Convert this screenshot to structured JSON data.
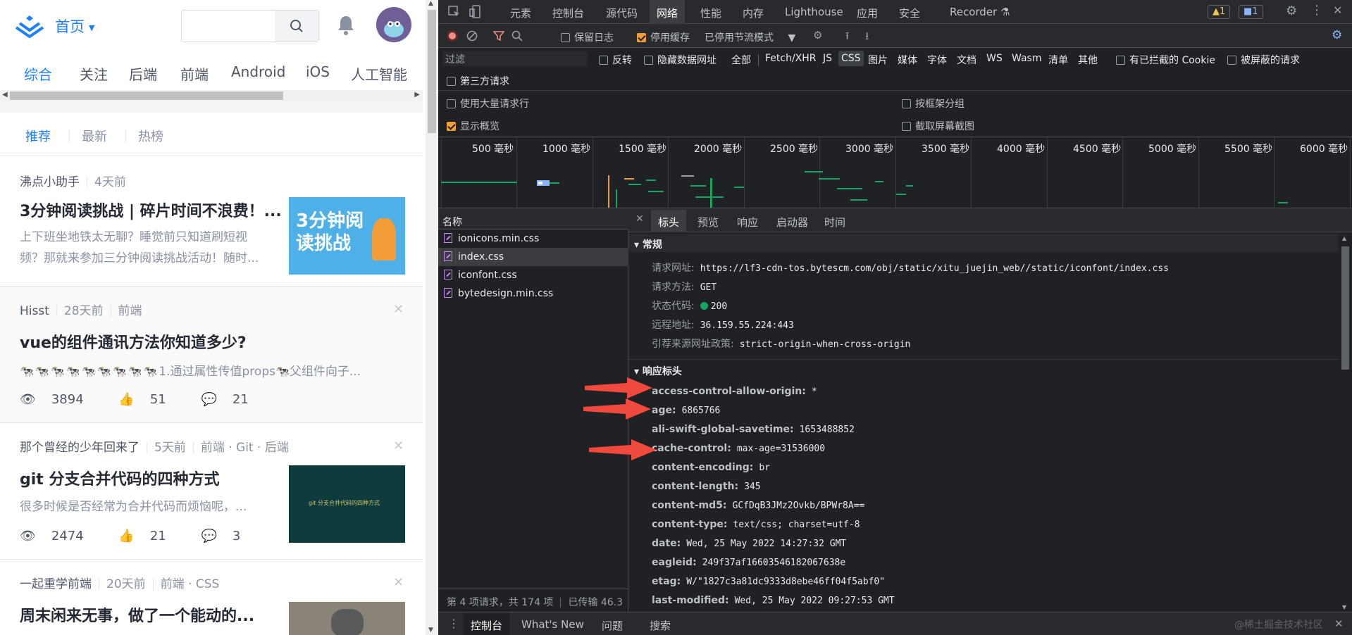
{
  "site": {
    "home_label": "首页",
    "categories": [
      "综合",
      "关注",
      "后端",
      "前端",
      "Android",
      "iOS",
      "人工智能"
    ],
    "subtabs": [
      "推荐",
      "最新",
      "热榜"
    ],
    "articles": [
      {
        "author": "沸点小助手",
        "time": "4天前",
        "tags": "",
        "title": "3分钟阅读挑战 | 碎片时间不浪费！...",
        "abstract1": "上下班坐地铁太无聊？睡觉前只知道刷短视",
        "abstract2": "频？那就来参加三分钟阅读挑战活动！随时...",
        "thumb_text": "3分钟阅读挑战"
      },
      {
        "author": "Hisst",
        "time": "28天前",
        "tags": "前端",
        "title": "vue的组件通讯方法你知道多少?",
        "abstract1": "1.通过属性传值props",
        "abstract1b": "父组件向子...",
        "views": "3894",
        "likes": "51",
        "comments": "21"
      },
      {
        "author": "那个曾经的少年回来了",
        "time": "5天前",
        "tags": "前端 · Git · 后端",
        "title": "git 分支合并代码的四种方式",
        "abstract1": "很多时候是否经常为合并代码而烦恼呢，...",
        "views": "2474",
        "likes": "21",
        "comments": "3",
        "thumb_text": "git 分支合并代码的四种方式"
      },
      {
        "author": "一起重学前端",
        "time": "20天前",
        "tags": "前端 · CSS",
        "title": "周末闲来无事，做了一个能动的..."
      }
    ]
  },
  "devtools": {
    "tabs": [
      "元素",
      "控制台",
      "源代码",
      "网络",
      "性能",
      "内存",
      "Lighthouse",
      "应用",
      "安全",
      "Recorder"
    ],
    "active_tab": "网络",
    "warn_count": "1",
    "msg_count": "1",
    "toolbar": {
      "preserve_log": "保留日志",
      "disable_cache": "停用缓存",
      "throttle": "已停用节流模式"
    },
    "filter": {
      "placeholder": "过滤",
      "invert": "反转",
      "hide_data_urls": "隐藏数据网址",
      "types": [
        "全部",
        "Fetch/XHR",
        "JS",
        "CSS",
        "图片",
        "媒体",
        "字体",
        "文档",
        "WS",
        "Wasm",
        "清单",
        "其他"
      ],
      "active_type": "CSS",
      "blocked_cookies": "有已拦截的 Cookie",
      "blocked_requests": "被屏蔽的请求",
      "third_party": "第三方请求"
    },
    "options": {
      "large_rows": "使用大量请求行",
      "group_by_frame": "按框架分组",
      "show_overview": "显示概览",
      "capture_screens": "截取屏幕截图"
    },
    "timeline_ticks": [
      "500 毫秒",
      "1000 毫秒",
      "1500 毫秒",
      "2000 毫秒",
      "2500 毫秒",
      "3000 毫秒",
      "3500 毫秒",
      "4000 毫秒",
      "4500 毫秒",
      "5000 毫秒",
      "5500 毫秒",
      "6000 毫秒"
    ],
    "name_header": "名称",
    "files": [
      "ionicons.min.css",
      "index.css",
      "iconfont.css",
      "bytedesign.min.css"
    ],
    "status_bar": "第 4 项请求，共 174 项",
    "status_bar2": "已传输 46.3",
    "detail_tabs": [
      "标头",
      "预览",
      "响应",
      "启动器",
      "时间"
    ],
    "general": {
      "title": "常规",
      "rows": [
        {
          "k": "请求网址:",
          "v": "https://lf3-cdn-tos.bytescm.com/obj/static/xitu_juejin_web//static/iconfont/index.css"
        },
        {
          "k": "请求方法:",
          "v": "GET"
        },
        {
          "k": "状态代码:",
          "v": "200"
        },
        {
          "k": "远程地址:",
          "v": "36.159.55.224:443"
        },
        {
          "k": "引荐来源网址政策:",
          "v": "strict-origin-when-cross-origin"
        }
      ]
    },
    "response_headers": {
      "title": "响应标头",
      "rows": [
        {
          "k": "access-control-allow-origin:",
          "v": "*"
        },
        {
          "k": "age:",
          "v": "6865766"
        },
        {
          "k": "ali-swift-global-savetime:",
          "v": "1653488852"
        },
        {
          "k": "cache-control:",
          "v": "max-age=31536000"
        },
        {
          "k": "content-encoding:",
          "v": "br"
        },
        {
          "k": "content-length:",
          "v": "345"
        },
        {
          "k": "content-md5:",
          "v": "GCfDqB3JMz2Ovkb/BPWr8A=="
        },
        {
          "k": "content-type:",
          "v": "text/css; charset=utf-8"
        },
        {
          "k": "date:",
          "v": "Wed, 25 May 2022 14:27:32 GMT"
        },
        {
          "k": "eagleid:",
          "v": "249f37af16603546182067638e"
        },
        {
          "k": "etag:",
          "v": "W/\"1827c3a81dc9333d8ebe46ff04f5abf0\""
        },
        {
          "k": "last-modified:",
          "v": "Wed, 25 May 2022 09:27:53 GMT"
        }
      ]
    },
    "drawer_tabs": [
      "控制台",
      "What's New",
      "问题",
      "搜索"
    ],
    "watermark": "@稀土掘金技术社区"
  }
}
